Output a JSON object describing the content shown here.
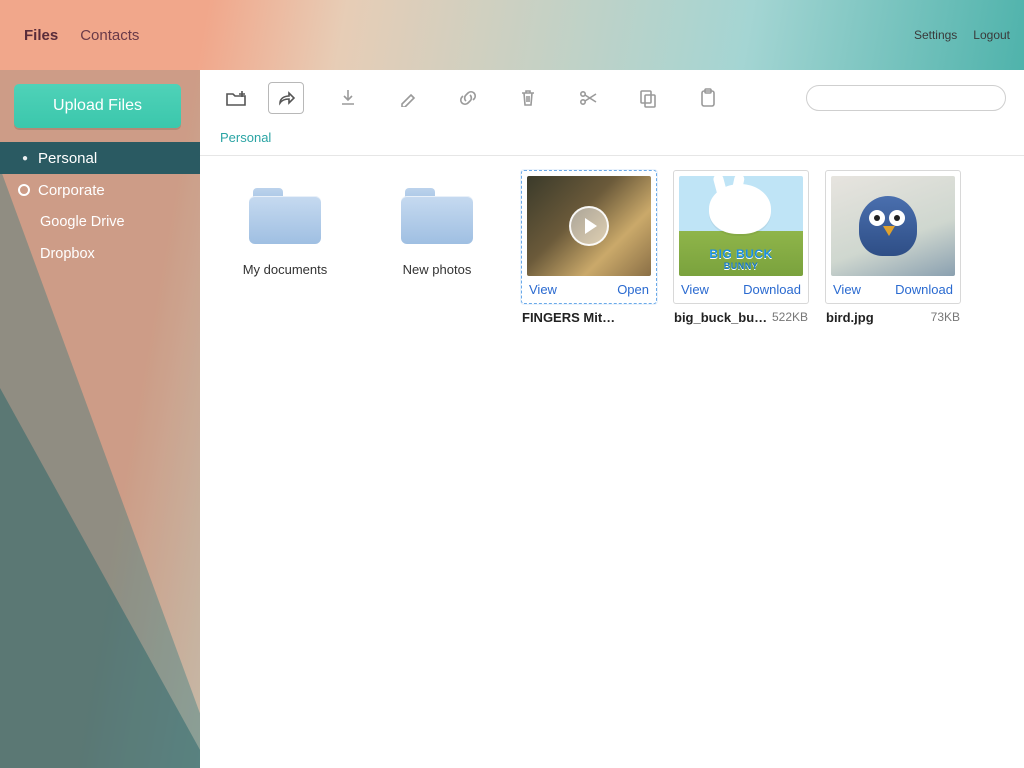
{
  "header": {
    "tabs": [
      {
        "label": "Files",
        "active": true
      },
      {
        "label": "Contacts",
        "active": false
      }
    ],
    "links": {
      "settings": "Settings",
      "logout": "Logout"
    }
  },
  "sidebar": {
    "upload_label": "Upload Files",
    "items": [
      {
        "label": "Personal",
        "kind": "bullet",
        "active": true
      },
      {
        "label": "Corporate",
        "kind": "radio",
        "active": false
      },
      {
        "label": "Google Drive",
        "kind": "child",
        "active": false
      },
      {
        "label": "Dropbox",
        "kind": "child",
        "active": false
      }
    ]
  },
  "toolbar": {
    "icons": [
      "new-folder",
      "share",
      "download",
      "edit",
      "link",
      "trash",
      "cut",
      "copy",
      "paste"
    ]
  },
  "search": {
    "placeholder": ""
  },
  "breadcrumb": {
    "root": "Personal"
  },
  "content": {
    "folders": [
      {
        "name": "My documents"
      },
      {
        "name": "New photos"
      }
    ],
    "files": [
      {
        "name": "FINGERS Mitchell C…",
        "size": "",
        "thumb": "video",
        "selected": true,
        "actions": {
          "left": "View",
          "right": "Open"
        }
      },
      {
        "name": "big_buck_bu…",
        "size": "522KB",
        "thumb": "bunny",
        "selected": false,
        "actions": {
          "left": "View",
          "right": "Download"
        }
      },
      {
        "name": "bird.jpg",
        "size": "73KB",
        "thumb": "bird",
        "selected": false,
        "actions": {
          "left": "View",
          "right": "Download"
        }
      }
    ]
  }
}
